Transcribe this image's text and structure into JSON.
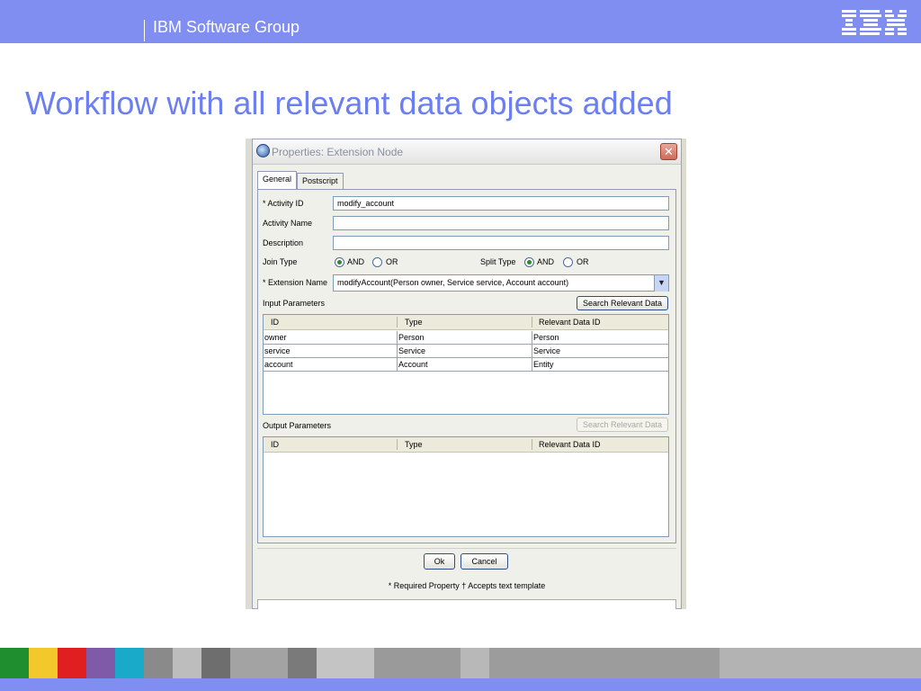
{
  "header": {
    "group_label": "IBM Software Group",
    "logo_text": "IBM",
    "accent_color": "#7f8ef0"
  },
  "slide_title": "Workflow with all relevant data objects added",
  "dialog": {
    "title": "Properties: Extension Node",
    "close_icon": "close-icon",
    "tabs": [
      "General",
      "Postscript"
    ],
    "fields": {
      "activity_id_label": "* Activity ID",
      "activity_id_value": "modify_account",
      "activity_name_label": "Activity Name",
      "activity_name_value": "",
      "description_label": "Description",
      "description_value": "",
      "join_type_label": "Join Type",
      "split_type_label": "Split Type",
      "radio_and": "AND",
      "radio_or": "OR",
      "join_selected": "AND",
      "split_selected": "AND",
      "extension_name_label": "* Extension Name",
      "extension_name_value": "modifyAccount(Person owner, Service service, Account account)"
    },
    "input_params": {
      "label": "Input Parameters",
      "search_button": "Search Relevant Data",
      "columns": [
        "ID",
        "Type",
        "Relevant Data ID"
      ],
      "rows": [
        [
          "owner",
          "Person",
          "Person"
        ],
        [
          "service",
          "Service",
          "Service"
        ],
        [
          "account",
          "Account",
          "Entity"
        ]
      ]
    },
    "output_params": {
      "label": "Output Parameters",
      "search_button": "Search Relevant Data",
      "columns": [
        "ID",
        "Type",
        "Relevant Data ID"
      ],
      "rows": []
    },
    "ok_button": "Ok",
    "cancel_button": "Cancel",
    "footnote": "* Required Property  † Accepts text template"
  },
  "footer_band_colors": [
    "#1e8e2f",
    "#f2c82b",
    "#e02020",
    "#7f5aa8",
    "#19a9c9",
    "#8a8a8a",
    "#bdbdbd",
    "#6e6e6e",
    "#a3a3a3",
    "#7a7a7a",
    "#c4c4c4",
    "#9a9a9a",
    "#b8b8b8",
    "#9c9c9c",
    "#b3b3b3"
  ]
}
